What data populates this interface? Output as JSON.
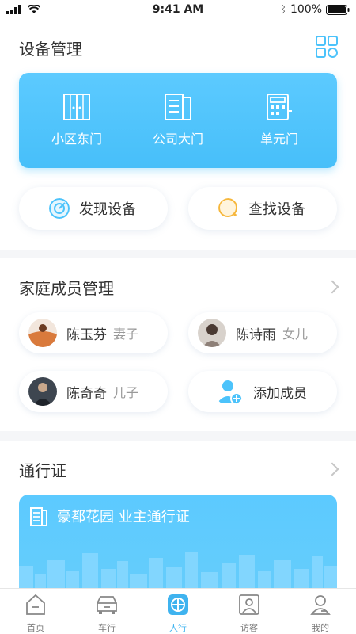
{
  "status_bar": {
    "time": "9:41 AM",
    "battery": "100%"
  },
  "device_section": {
    "title": "设备管理",
    "doors": [
      {
        "label": "小区东门",
        "icon": "gate-icon"
      },
      {
        "label": "公司大门",
        "icon": "document-door-icon"
      },
      {
        "label": "单元门",
        "icon": "keypad-door-icon"
      }
    ],
    "actions": [
      {
        "label": "发现设备",
        "icon": "radar-icon"
      },
      {
        "label": "查找设备",
        "icon": "search-icon"
      }
    ]
  },
  "family_section": {
    "title": "家庭成员管理",
    "members": [
      {
        "name": "陈玉芬",
        "relation": "妻子"
      },
      {
        "name": "陈诗雨",
        "relation": "女儿"
      },
      {
        "name": "陈奇奇",
        "relation": "儿子"
      }
    ],
    "add_label": "添加成员"
  },
  "pass_section": {
    "title": "通行证",
    "card_title": "豪都花园 业主通行证"
  },
  "tabs": [
    {
      "label": "首页",
      "icon": "home-icon"
    },
    {
      "label": "车行",
      "icon": "car-icon"
    },
    {
      "label": "人行",
      "icon": "person-walk-icon",
      "active": true
    },
    {
      "label": "访客",
      "icon": "visitor-icon"
    },
    {
      "label": "我的",
      "icon": "profile-icon"
    }
  ],
  "colors": {
    "accent": "#4cc3fb",
    "tab_active": "#3fb3ef"
  }
}
